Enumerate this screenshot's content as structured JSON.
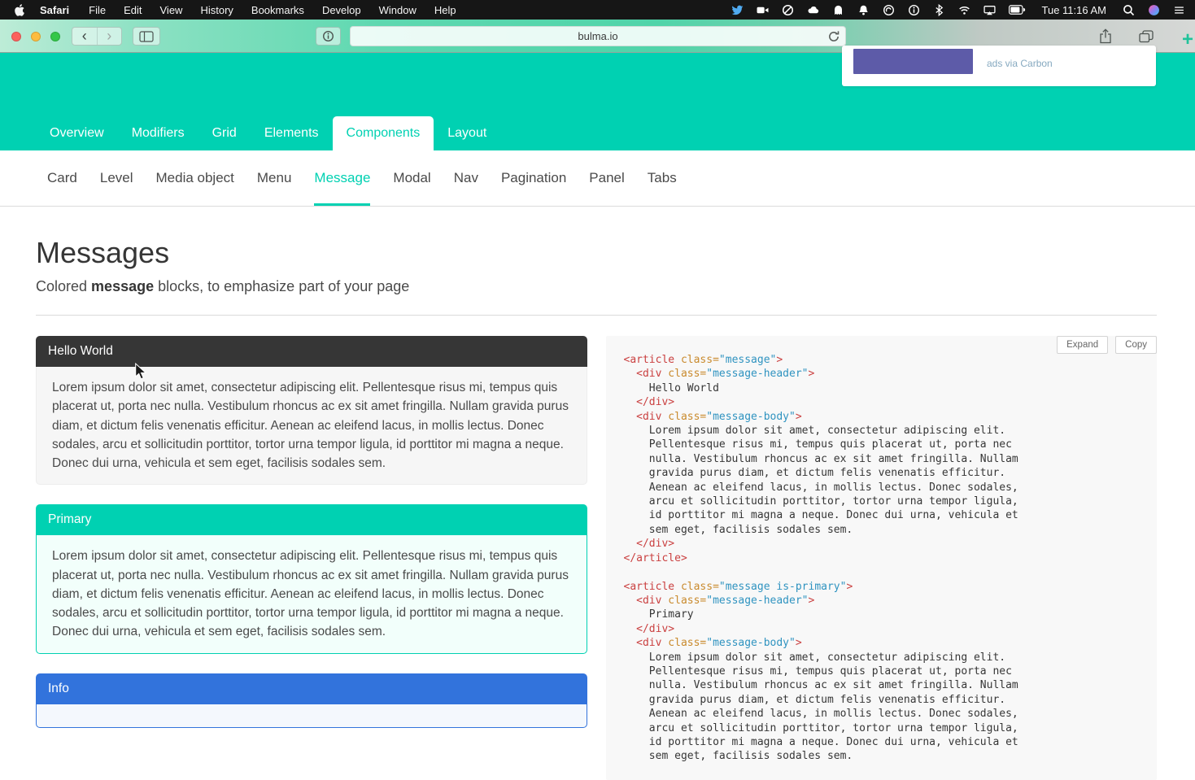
{
  "colors": {
    "primary": "#00d1b2",
    "dark": "#363636",
    "info": "#3273dc",
    "text": "#4a4a4a"
  },
  "menubar": {
    "app_name": "Safari",
    "menus": [
      "File",
      "Edit",
      "View",
      "History",
      "Bookmarks",
      "Develop",
      "Window",
      "Help"
    ],
    "status_icons": [
      "twitter",
      "screen-record",
      "do-not-disturb",
      "icloud",
      "ghost-app",
      "notification-bell",
      "spiral-app",
      "info-circle",
      "bluetooth",
      "wifi",
      "airplay",
      "battery"
    ],
    "clock": "Tue 11:16 AM",
    "system_icons": [
      "spotlight",
      "siri",
      "notification-center"
    ]
  },
  "browser": {
    "url": "bulma.io"
  },
  "hero": {
    "tabs": [
      {
        "label": "Overview",
        "active": false
      },
      {
        "label": "Modifiers",
        "active": false
      },
      {
        "label": "Grid",
        "active": false
      },
      {
        "label": "Elements",
        "active": false
      },
      {
        "label": "Components",
        "active": true
      },
      {
        "label": "Layout",
        "active": false
      }
    ],
    "ad_caption": "ads via Carbon"
  },
  "subnav": {
    "items": [
      {
        "label": "Card",
        "active": false
      },
      {
        "label": "Level",
        "active": false
      },
      {
        "label": "Media object",
        "active": false
      },
      {
        "label": "Menu",
        "active": false
      },
      {
        "label": "Message",
        "active": true
      },
      {
        "label": "Modal",
        "active": false
      },
      {
        "label": "Nav",
        "active": false
      },
      {
        "label": "Pagination",
        "active": false
      },
      {
        "label": "Panel",
        "active": false
      },
      {
        "label": "Tabs",
        "active": false
      }
    ]
  },
  "page": {
    "title": "Messages",
    "subtitle": [
      "Colored ",
      "message",
      " blocks, to emphasize part of your page"
    ]
  },
  "messages": [
    {
      "title": "Hello World",
      "header_bg": "#363636",
      "header_color": "#ffffff",
      "body_bg": "#f6f6f6",
      "body_border": "#ededed",
      "body_color": "#4a4a4a",
      "body": "Lorem ipsum dolor sit amet, consectetur adipiscing elit. Pellentesque risus mi, tempus quis placerat ut, porta nec nulla. Vestibulum rhoncus ac ex sit amet fringilla. Nullam gravida purus diam, et dictum felis venenatis efficitur. Aenean ac eleifend lacus, in mollis lectus. Donec sodales, arcu et sollicitudin porttitor, tortor urna tempor ligula, id porttitor mi magna a neque. Donec dui urna, vehicula et sem eget, facilisis sodales sem."
    },
    {
      "title": "Primary",
      "header_bg": "#00d1b2",
      "header_color": "#ffffff",
      "body_bg": "#f2fffb",
      "body_border": "#00d1b2",
      "body_color": "#4a4a4a",
      "body": "Lorem ipsum dolor sit amet, consectetur adipiscing elit. Pellentesque risus mi, tempus quis placerat ut, porta nec nulla. Vestibulum rhoncus ac ex sit amet fringilla. Nullam gravida purus diam, et dictum felis venenatis efficitur. Aenean ac eleifend lacus, in mollis lectus. Donec sodales, arcu et sollicitudin porttitor, tortor urna tempor ligula, id porttitor mi magna a neque. Donec dui urna, vehicula et sem eget, facilisis sodales sem."
    },
    {
      "title": "Info",
      "header_bg": "#3273dc",
      "header_color": "#ffffff",
      "body_bg": "#f4f8fd",
      "body_border": "#3273dc",
      "body_color": "#4a4a4a",
      "body": ""
    }
  ],
  "code_panel": {
    "expand_label": "Expand",
    "copy_label": "Copy",
    "lines": [
      [
        [
          "t",
          "<article "
        ],
        [
          "a",
          "class="
        ],
        [
          "s",
          "\"message\""
        ],
        [
          "t",
          ">"
        ]
      ],
      [
        [
          "p",
          "  "
        ],
        [
          "t",
          "<div "
        ],
        [
          "a",
          "class="
        ],
        [
          "s",
          "\"message-header\""
        ],
        [
          "t",
          ">"
        ]
      ],
      [
        [
          "p",
          "    Hello World"
        ]
      ],
      [
        [
          "p",
          "  "
        ],
        [
          "t",
          "</div>"
        ]
      ],
      [
        [
          "p",
          "  "
        ],
        [
          "t",
          "<div "
        ],
        [
          "a",
          "class="
        ],
        [
          "s",
          "\"message-body\""
        ],
        [
          "t",
          ">"
        ]
      ],
      [
        [
          "p",
          "    Lorem ipsum dolor sit amet, consectetur adipiscing elit."
        ]
      ],
      [
        [
          "p",
          "    Pellentesque risus mi, tempus quis placerat ut, porta nec"
        ]
      ],
      [
        [
          "p",
          "    nulla. Vestibulum rhoncus ac ex sit amet fringilla. Nullam"
        ]
      ],
      [
        [
          "p",
          "    gravida purus diam, et dictum felis venenatis efficitur."
        ]
      ],
      [
        [
          "p",
          "    Aenean ac eleifend lacus, in mollis lectus. Donec sodales,"
        ]
      ],
      [
        [
          "p",
          "    arcu et sollicitudin porttitor, tortor urna tempor ligula,"
        ]
      ],
      [
        [
          "p",
          "    id porttitor mi magna a neque. Donec dui urna, vehicula et"
        ]
      ],
      [
        [
          "p",
          "    sem eget, facilisis sodales sem."
        ]
      ],
      [
        [
          "p",
          "  "
        ],
        [
          "t",
          "</div>"
        ]
      ],
      [
        [
          "t",
          "</article>"
        ]
      ],
      [],
      [
        [
          "t",
          "<article "
        ],
        [
          "a",
          "class="
        ],
        [
          "s",
          "\"message is-primary\""
        ],
        [
          "t",
          ">"
        ]
      ],
      [
        [
          "p",
          "  "
        ],
        [
          "t",
          "<div "
        ],
        [
          "a",
          "class="
        ],
        [
          "s",
          "\"message-header\""
        ],
        [
          "t",
          ">"
        ]
      ],
      [
        [
          "p",
          "    Primary"
        ]
      ],
      [
        [
          "p",
          "  "
        ],
        [
          "t",
          "</div>"
        ]
      ],
      [
        [
          "p",
          "  "
        ],
        [
          "t",
          "<div "
        ],
        [
          "a",
          "class="
        ],
        [
          "s",
          "\"message-body\""
        ],
        [
          "t",
          ">"
        ]
      ],
      [
        [
          "p",
          "    Lorem ipsum dolor sit amet, consectetur adipiscing elit."
        ]
      ],
      [
        [
          "p",
          "    Pellentesque risus mi, tempus quis placerat ut, porta nec"
        ]
      ],
      [
        [
          "p",
          "    nulla. Vestibulum rhoncus ac ex sit amet fringilla. Nullam"
        ]
      ],
      [
        [
          "p",
          "    gravida purus diam, et dictum felis venenatis efficitur."
        ]
      ],
      [
        [
          "p",
          "    Aenean ac eleifend lacus, in mollis lectus. Donec sodales,"
        ]
      ],
      [
        [
          "p",
          "    arcu et sollicitudin porttitor, tortor urna tempor ligula,"
        ]
      ],
      [
        [
          "p",
          "    id porttitor mi magna a neque. Donec dui urna, vehicula et"
        ]
      ],
      [
        [
          "p",
          "    sem eget, facilisis sodales sem."
        ]
      ]
    ]
  }
}
